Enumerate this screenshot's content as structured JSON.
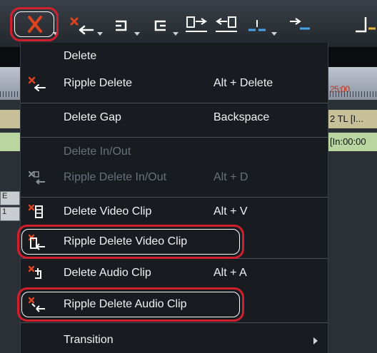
{
  "toolbar": {
    "buttons": [
      {
        "name": "delete-button",
        "icon": "delete-x-icon"
      },
      {
        "name": "ripple-delete-button",
        "icon": "ripple-delete-icon"
      },
      {
        "name": "undo-button",
        "icon": "undo-icon"
      },
      {
        "name": "redo-button",
        "icon": "redo-icon"
      },
      {
        "name": "set-in-button",
        "icon": "set-in-icon"
      },
      {
        "name": "set-out-button",
        "icon": "set-out-icon"
      },
      {
        "name": "split-button",
        "icon": "split-icon"
      },
      {
        "name": "add-cut-button",
        "icon": "add-cut-icon"
      }
    ]
  },
  "timeline": {
    "ruler_time": "25;00",
    "track_label_1": "2 TL [I...",
    "track_label_2": "[In:00:00",
    "row_1": "E",
    "row_2": "1"
  },
  "menu": {
    "items": [
      {
        "label": "Delete",
        "shortcut": "",
        "enabled": true,
        "icon": ""
      },
      {
        "label": "Ripple Delete",
        "shortcut": "Alt + Delete",
        "enabled": true,
        "icon": "ripple-delete-icon"
      },
      {
        "label": "Delete Gap",
        "shortcut": "Backspace",
        "enabled": true,
        "icon": ""
      },
      {
        "label": "Delete In/Out",
        "shortcut": "",
        "enabled": false,
        "icon": ""
      },
      {
        "label": "Ripple Delete In/Out",
        "shortcut": "Alt + D",
        "enabled": false,
        "icon": "ripple-delete-inout-icon"
      },
      {
        "label": "Delete Video Clip",
        "shortcut": "Alt + V",
        "enabled": true,
        "icon": "delete-video-clip-icon"
      },
      {
        "label": "Ripple Delete Video Clip",
        "shortcut": "",
        "enabled": true,
        "icon": "ripple-delete-video-clip-icon",
        "highlighted": true
      },
      {
        "label": "Delete Audio Clip",
        "shortcut": "Alt + A",
        "enabled": true,
        "icon": "delete-audio-clip-icon"
      },
      {
        "label": "Ripple Delete Audio Clip",
        "shortcut": "",
        "enabled": true,
        "icon": "ripple-delete-audio-clip-icon",
        "highlighted": true
      },
      {
        "label": "Transition",
        "shortcut": "",
        "enabled": true,
        "icon": "",
        "has_submenu": true
      }
    ]
  },
  "colors": {
    "highlight_ring": "#d21f2d",
    "icon_red": "#e0421e",
    "menu_bg": "#181b20",
    "disabled_text": "#6b717a"
  }
}
